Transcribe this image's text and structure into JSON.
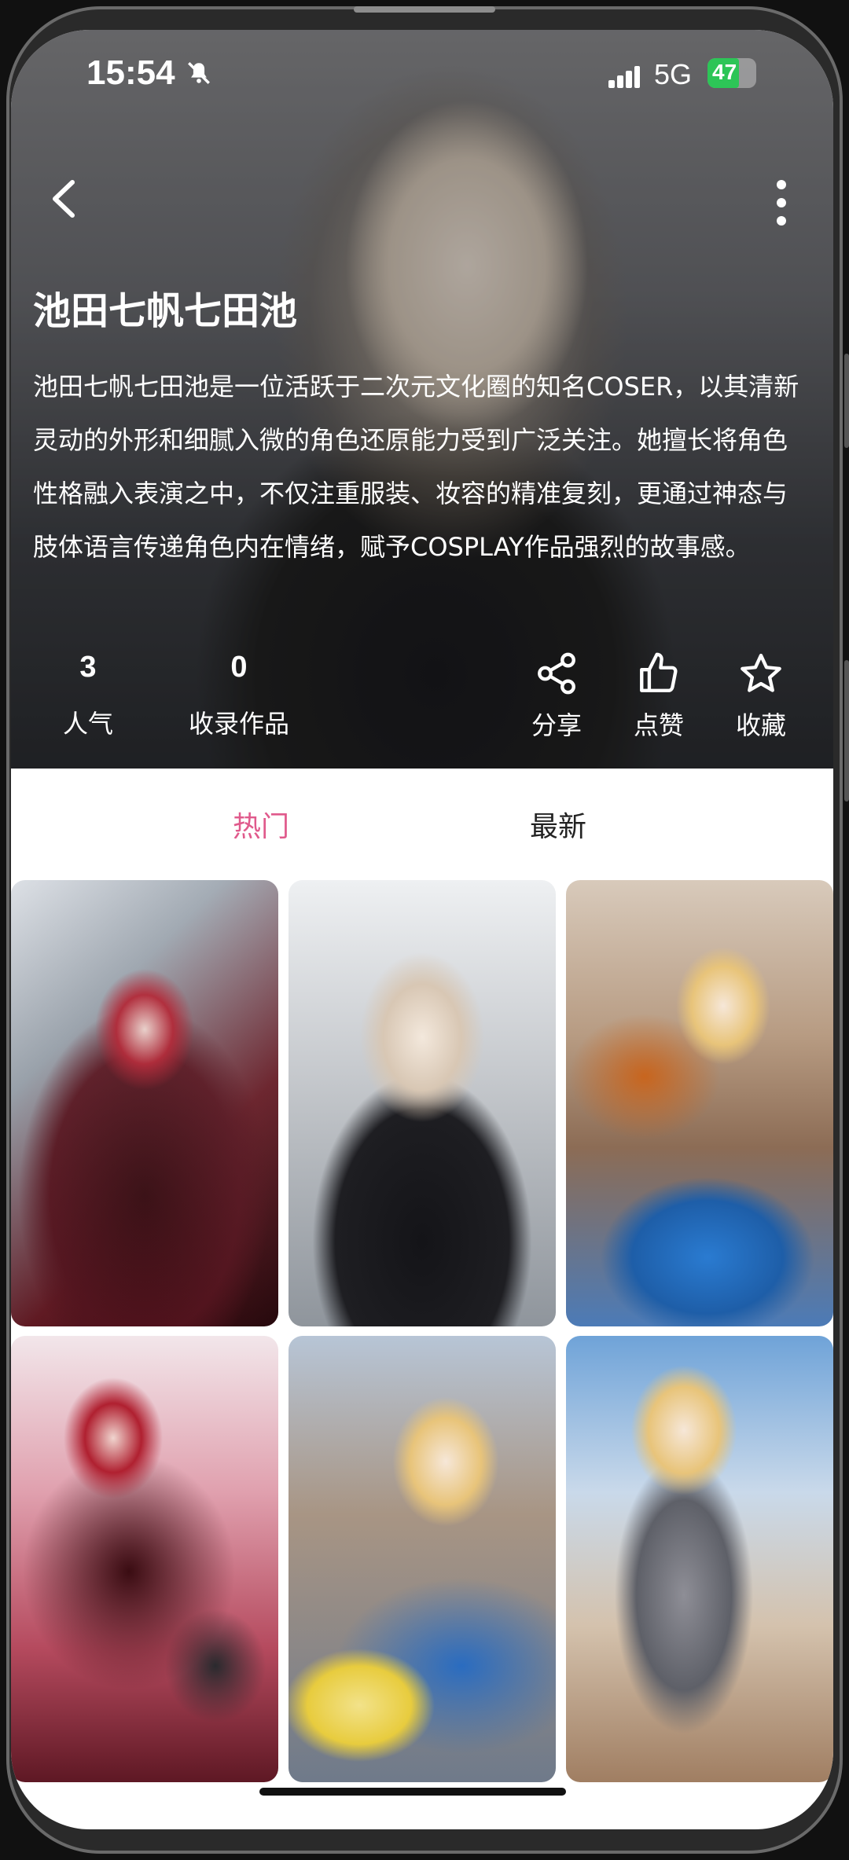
{
  "status_bar": {
    "time": "15:54",
    "network": "5G",
    "battery": "47"
  },
  "profile": {
    "name": "池田七帆七田池",
    "description": "池田七帆七田池是一位活跃于二次元文化圈的知名COSER，以其清新灵动的外形和细腻入微的角色还原能力受到广泛关注。她擅长将角色性格融入表演之中，不仅注重服装、妆容的精准复刻，更通过神态与肢体语言传递角色内在情绪，赋予COSPLAY作品强烈的故事感。"
  },
  "stats": {
    "popularity_value": "3",
    "popularity_label": "人气",
    "works_value": "0",
    "works_label": "收录作品"
  },
  "actions": {
    "share": "分享",
    "like": "点赞",
    "favorite": "收藏"
  },
  "tabs": {
    "hot": "热门",
    "latest": "最新"
  },
  "colors": {
    "accent": "#e05a8c",
    "battery_green": "#2dc557"
  },
  "icons": {
    "back": "chevron-left-icon",
    "more": "more-vertical-icon",
    "share": "share-icon",
    "like": "thumbs-up-icon",
    "favorite": "star-icon",
    "silent": "bell-off-icon",
    "signal": "signal-icon"
  }
}
